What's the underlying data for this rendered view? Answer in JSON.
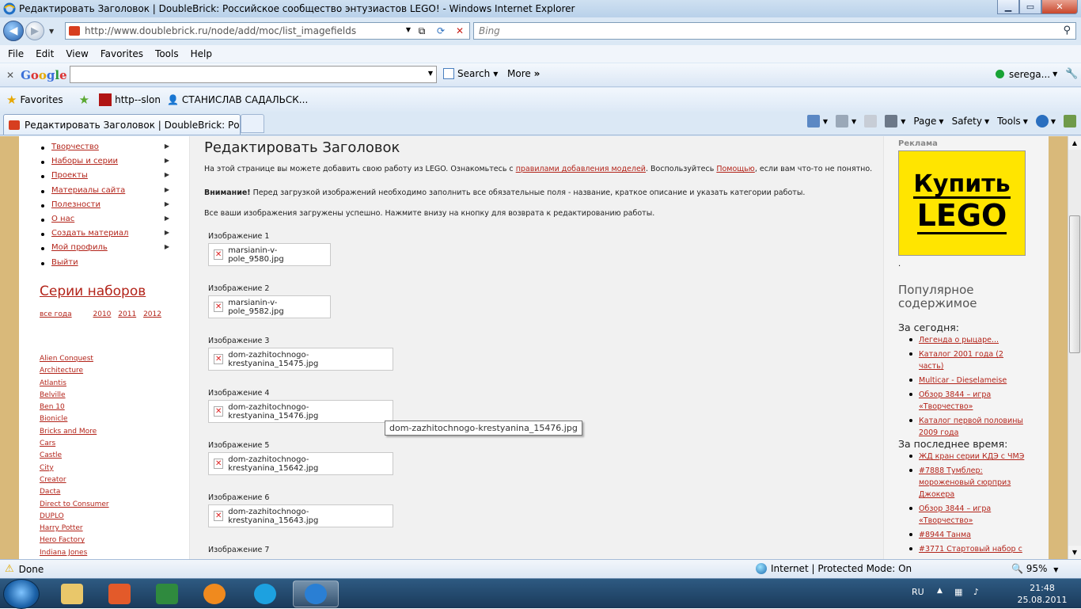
{
  "window": {
    "title": "Редактировать Заголовок | DoubleBrick: Российское сообщество энтузиастов LEGO! - Windows Internet Explorer",
    "min": "▁",
    "max": "▭",
    "close": "✕"
  },
  "nav": {
    "url": "http://www.doublebrick.ru/node/add/moc/list_imagefields",
    "search_placeholder": "Bing"
  },
  "menu": [
    "File",
    "Edit",
    "View",
    "Favorites",
    "Tools",
    "Help"
  ],
  "google": {
    "logo": "Google",
    "search_label": "Search",
    "more_label": "More",
    "user": "serega..."
  },
  "favorites": {
    "label": "Favorites",
    "items": [
      "http--slon",
      "СТАНИСЛАВ САДАЛЬСК..."
    ]
  },
  "tab": {
    "title": "Редактировать Заголовок | DoubleBrick: Россий..."
  },
  "commands": [
    "Page",
    "Safety",
    "Tools"
  ],
  "sidebar": {
    "menu": [
      "Творчество",
      "Наборы и серии",
      "Проекты",
      "Материалы сайта",
      "Полезности",
      "О нас",
      "Создать материал",
      "Мой профиль",
      "Выйти"
    ],
    "series_heading": "Серии наборов",
    "years": [
      "все года",
      "2010",
      "2011",
      "2012"
    ],
    "themes": [
      "Alien Conquest",
      "Architecture",
      "Atlantis",
      "Belville",
      "Ben 10",
      "Bionicle",
      "Bricks and More",
      "Cars",
      "Castle",
      "City",
      "Creator",
      "Dacta",
      "Direct to Consumer",
      "DUPLO",
      "Harry Potter",
      "Hero Factory",
      "Indiana Jones"
    ]
  },
  "main": {
    "title": "Редактировать Заголовок",
    "p1_a": "На этой странице вы можете добавить свою работу из LEGO. Ознакомьтесь с ",
    "p1_link1": "правилами добавления моделей",
    "p1_b": ". Воспользуйтесь ",
    "p1_link2": "Помощью",
    "p1_c": ", если вам что-то не понятно.",
    "p2_bold": "Внимание!",
    "p2_text": " Перед загрузкой изображений необходимо заполнить все обязательные поля - название, краткое описание и указать категории работы.",
    "p3": "Все ваши изображения загружены успешно. Нажмите внизу на кнопку для возврата к редактированию работы.",
    "images": [
      {
        "label": "Изображение 1",
        "file": "marsianin-v-pole_9580.jpg"
      },
      {
        "label": "Изображение 2",
        "file": "marsianin-v-pole_9582.jpg"
      },
      {
        "label": "Изображение 3",
        "file": "dom-zazhitochnogo-krestyanina_15475.jpg"
      },
      {
        "label": "Изображение 4",
        "file": "dom-zazhitochnogo-krestyanina_15476.jpg"
      },
      {
        "label": "Изображение 5",
        "file": "dom-zazhitochnogo-krestyanina_15642.jpg"
      },
      {
        "label": "Изображение 6",
        "file": "dom-zazhitochnogo-krestyanina_15643.jpg"
      },
      {
        "label": "Изображение 7",
        "file": ""
      }
    ],
    "tooltip": "dom-zazhitochnogo-krestyanina_15476.jpg"
  },
  "right": {
    "ad_heading": "Реклама",
    "ad_line1": "Купить",
    "ad_line2": "LEGO",
    "popular_heading": "Популярное содержимое",
    "today_heading": "За сегодня:",
    "today": [
      "Легенда о рыцаре...",
      "Каталог 2001 года (2 часть)",
      "Multicar - Dieselameise",
      "Обзор 3844 – игра «Творчество»",
      "Каталог первой половины 2009 года"
    ],
    "recent_heading": "За последнее время:",
    "recent": [
      "ЖД кран серии КДЭ с ЧМЭ",
      "#7888 Тумблер: мороженовый сюрприз Джокера",
      "Обзор 3844 – игра «Творчество»",
      "#8944 Танма",
      "#3771 Стартовый набор с"
    ]
  },
  "status": {
    "text": "Done",
    "zone": "Internet | Protected Mode: On",
    "zoom": "95%"
  },
  "taskbar": {
    "lang": "RU",
    "time": "21:48",
    "date": "25.08.2011"
  },
  "colors": {
    "link": "#b3241a",
    "page_bg": "#d9b97a",
    "ad_bg": "#ffe500"
  }
}
